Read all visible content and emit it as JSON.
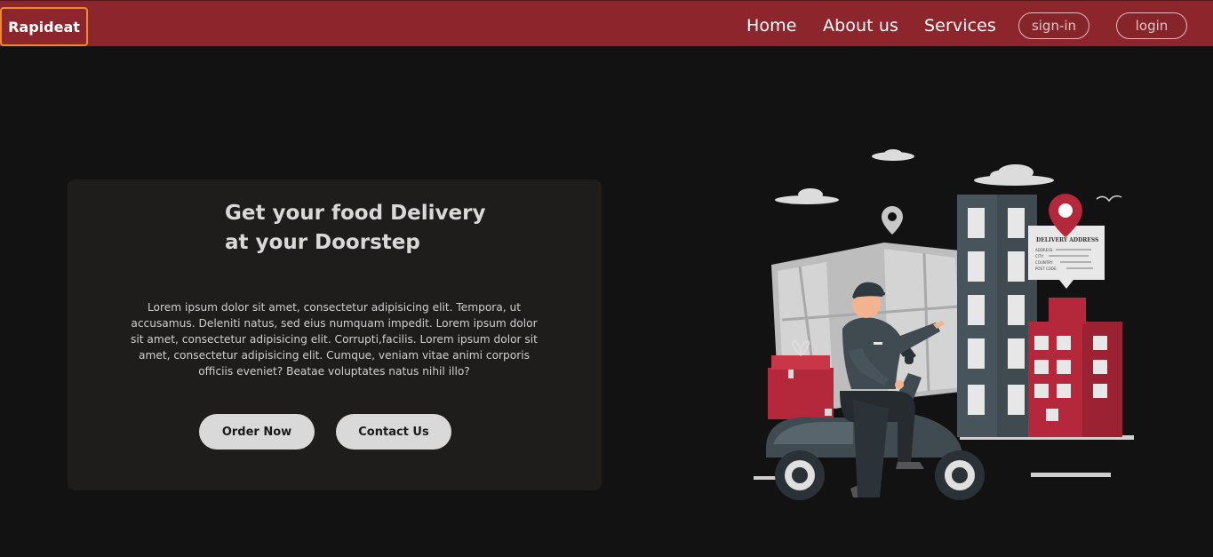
{
  "nav": {
    "logo": "Rapideat",
    "links": [
      "Home",
      "About us",
      "Services"
    ],
    "signin_label": "sign-in",
    "login_label": "login"
  },
  "hero": {
    "title_line1": "Get your food Delivery",
    "title_line2": "at your Doorstep",
    "description": "Lorem ipsum dolor sit amet, consectetur adipisicing elit. Tempora, ut accusamus. Deleniti natus, sed eius numquam impedit. Lorem ipsum dolor sit amet, consectetur adipisicing elit. Corrupti,facilis. Lorem ipsum dolor sit amet, consectetur adipisicing elit. Cumque, veniam vitae animi corporis officiis eveniet? Beatae voluptates natus nihil illo?",
    "order_label": "Order Now",
    "contact_label": "Contact Us"
  },
  "illustration": {
    "address_card": {
      "heading": "DELIVERY ADDRESS",
      "fields": [
        "ADDRESS:",
        "CITY:",
        "COUNTRY:",
        "POST CODE:"
      ]
    }
  },
  "colors": {
    "navbar": "#8d262c",
    "background": "#121212",
    "card": "#1f1c1c",
    "logo_border": "#ef8a2b",
    "button": "#d9d9d9",
    "accent_red": "#b5273a"
  }
}
